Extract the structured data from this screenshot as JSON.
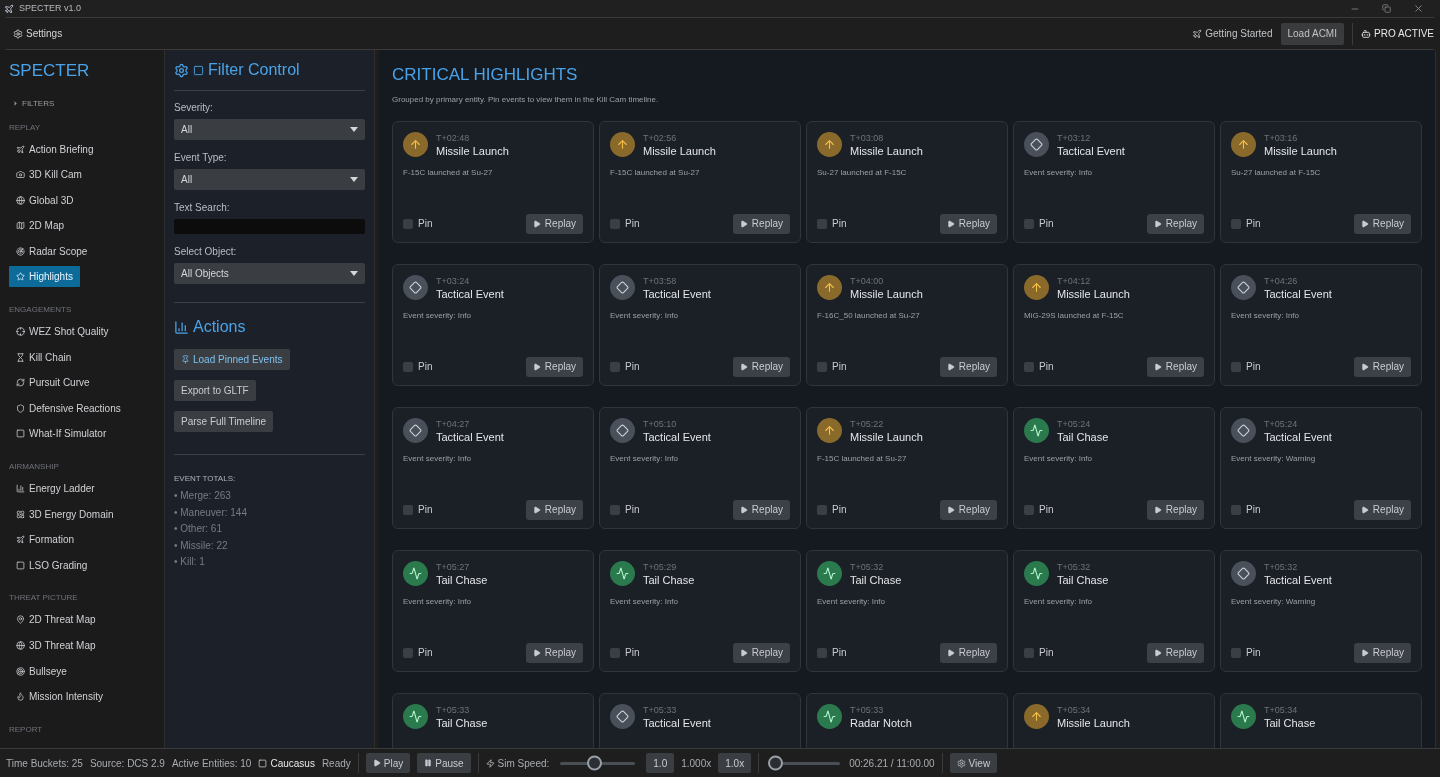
{
  "window": {
    "title": "SPECTER v1.0"
  },
  "menu": {
    "settings": "Settings",
    "getting_started": "Getting Started",
    "load": "Load ACMI",
    "pro": "PRO ACTIVE"
  },
  "sidebar": {
    "brand": "SPECTER",
    "filters": "FILTERS",
    "sections": [
      {
        "title": "REPLAY",
        "items": [
          {
            "label": "Action Briefing",
            "selected": false
          },
          {
            "label": "3D Kill Cam",
            "selected": false
          },
          {
            "label": "Global 3D",
            "selected": false
          },
          {
            "label": "2D Map",
            "selected": false
          },
          {
            "label": "Radar Scope",
            "selected": false
          },
          {
            "label": "Highlights",
            "selected": true
          }
        ]
      },
      {
        "title": "ENGAGEMENTS",
        "items": [
          {
            "label": "WEZ Shot Quality",
            "selected": false
          },
          {
            "label": "Kill Chain",
            "selected": false
          },
          {
            "label": "Pursuit Curve",
            "selected": false
          },
          {
            "label": "Defensive Reactions",
            "selected": false
          },
          {
            "label": "What-If Simulator",
            "selected": false
          }
        ]
      },
      {
        "title": "AIRMANSHIP",
        "items": [
          {
            "label": "Energy Ladder",
            "selected": false
          },
          {
            "label": "3D Energy Domain",
            "selected": false
          },
          {
            "label": "Formation",
            "selected": false
          },
          {
            "label": "LSO Grading",
            "selected": false
          }
        ]
      },
      {
        "title": "THREAT PICTURE",
        "items": [
          {
            "label": "2D Threat Map",
            "selected": false
          },
          {
            "label": "3D Threat Map",
            "selected": false
          },
          {
            "label": "Bullseye",
            "selected": false
          },
          {
            "label": "Mission Intensity",
            "selected": false
          }
        ]
      },
      {
        "title": "REPORT"
      }
    ]
  },
  "filter": {
    "title": "Filter Control",
    "fields": [
      {
        "kind": "select",
        "label": "Severity:",
        "value": "All"
      },
      {
        "kind": "select",
        "label": "Event Type:",
        "value": "All"
      },
      {
        "kind": "text",
        "label": "Text Search:"
      },
      {
        "kind": "select",
        "label": "Select Object:",
        "value": "All Objects"
      }
    ],
    "actions_title": "Actions",
    "actions": [
      {
        "label": "Load Pinned Events",
        "accent": true
      },
      {
        "label": "Export to GLTF",
        "accent": false
      },
      {
        "label": "Parse Full Timeline",
        "accent": false
      }
    ],
    "totals_title": "EVENT TOTALS:",
    "totals": [
      "• Merge: 263",
      "• Maneuver: 144",
      "• Other: 61",
      "• Missile: 22",
      "• Kill: 1"
    ]
  },
  "highlights": {
    "title": "CRITICAL HIGHLIGHTS",
    "subtitle": "Grouped by primary entity. Pin events to view them in the Kill Cam timeline.",
    "cards": [
      {
        "kind": "missile",
        "time": "T+02:48",
        "title": "Missile Launch",
        "description": "F-15C launched at Su-27",
        "pinned": false,
        "pin_label": "Pin",
        "action": "Replay"
      },
      {
        "kind": "missile",
        "time": "T+02:56",
        "title": "Missile Launch",
        "description": "F-15C launched at Su-27",
        "pinned": false,
        "pin_label": "Pin",
        "action": "Replay"
      },
      {
        "kind": "missile",
        "time": "T+03:08",
        "title": "Missile Launch",
        "description": "Su-27 launched at F-15C",
        "pinned": false,
        "pin_label": "Pin",
        "action": "Replay"
      },
      {
        "kind": "tactical",
        "time": "T+03:12",
        "title": "Tactical Event",
        "description": "Event severity: Info",
        "pinned": false,
        "pin_label": "Pin",
        "action": "Replay"
      },
      {
        "kind": "missile",
        "time": "T+03:16",
        "title": "Missile Launch",
        "description": "Su-27 launched at F-15C",
        "pinned": false,
        "pin_label": "Pin",
        "action": "Replay"
      },
      {
        "kind": "tactical",
        "time": "T+03:24",
        "title": "Tactical Event",
        "description": "Event severity: Info",
        "pinned": false,
        "pin_label": "Pin",
        "action": "Replay"
      },
      {
        "kind": "tactical",
        "time": "T+03:58",
        "title": "Tactical Event",
        "description": "Event severity: Info",
        "pinned": false,
        "pin_label": "Pin",
        "action": "Replay"
      },
      {
        "kind": "missile",
        "time": "T+04:00",
        "title": "Missile Launch",
        "description": "F-16C_50 launched at Su-27",
        "pinned": false,
        "pin_label": "Pin",
        "action": "Replay"
      },
      {
        "kind": "missile",
        "time": "T+04:12",
        "title": "Missile Launch",
        "description": "MiG-29S launched at F-15C",
        "pinned": false,
        "pin_label": "Pin",
        "action": "Replay"
      },
      {
        "kind": "tactical",
        "time": "T+04:26",
        "title": "Tactical Event",
        "description": "Event severity: Info",
        "pinned": false,
        "pin_label": "Pin",
        "action": "Replay"
      },
      {
        "kind": "tactical",
        "time": "T+04:27",
        "title": "Tactical Event",
        "description": "Event severity: Info",
        "pinned": false,
        "pin_label": "Pin",
        "action": "Replay"
      },
      {
        "kind": "tactical",
        "time": "T+05:10",
        "title": "Tactical Event",
        "description": "Event severity: Info",
        "pinned": false,
        "pin_label": "Pin",
        "action": "Replay"
      },
      {
        "kind": "missile",
        "time": "T+05:22",
        "title": "Missile Launch",
        "description": "F-15C launched at Su-27",
        "pinned": false,
        "pin_label": "Pin",
        "action": "Replay"
      },
      {
        "kind": "chase",
        "time": "T+05:24",
        "title": "Tail Chase",
        "description": "Event severity: Info",
        "pinned": false,
        "pin_label": "Pin",
        "action": "Replay"
      },
      {
        "kind": "tactical",
        "time": "T+05:24",
        "title": "Tactical Event",
        "description": "Event severity: Warning",
        "pinned": false,
        "pin_label": "Pin",
        "action": "Replay"
      },
      {
        "kind": "chase",
        "time": "T+05:27",
        "title": "Tail Chase",
        "description": "Event severity: Info",
        "pinned": false,
        "pin_label": "Pin",
        "action": "Replay"
      },
      {
        "kind": "chase",
        "time": "T+05:29",
        "title": "Tail Chase",
        "description": "Event severity: Info",
        "pinned": false,
        "pin_label": "Pin",
        "action": "Replay"
      },
      {
        "kind": "chase",
        "time": "T+05:32",
        "title": "Tail Chase",
        "description": "Event severity: Info",
        "pinned": false,
        "pin_label": "Pin",
        "action": "Replay"
      },
      {
        "kind": "chase",
        "time": "T+05:32",
        "title": "Tail Chase",
        "description": "Event severity: Info",
        "pinned": false,
        "pin_label": "Pin",
        "action": "Replay"
      },
      {
        "kind": "tactical",
        "time": "T+05:32",
        "title": "Tactical Event",
        "description": "Event severity: Warning",
        "pinned": false,
        "pin_label": "Pin",
        "action": "Replay"
      },
      {
        "kind": "chase",
        "time": "T+05:33",
        "title": "Tail Chase"
      },
      {
        "kind": "tactical",
        "time": "T+05:33",
        "title": "Tactical Event"
      },
      {
        "kind": "chase",
        "time": "T+05:33",
        "title": "Radar Notch"
      },
      {
        "kind": "missile",
        "time": "T+05:34",
        "title": "Missile Launch"
      },
      {
        "kind": "chase",
        "time": "T+05:34",
        "title": "Tail Chase"
      }
    ]
  },
  "status_bar": {
    "items": [
      "Time Buckets: 25",
      "Source: DCS 2.9",
      "Active Entities: 10"
    ],
    "map": "Caucasus",
    "state": "Ready",
    "play": "Play",
    "pause": "Pause",
    "sim_label": "Sim Speed:",
    "sim_speed": {
      "level": 0.45
    },
    "speed_value": "1.0",
    "speed_multiplier": "1.000x",
    "speed_button": "1.0x",
    "timeline": {
      "level": 0.04
    },
    "time": "00:26.21 / 11:00.00",
    "view": "View"
  }
}
